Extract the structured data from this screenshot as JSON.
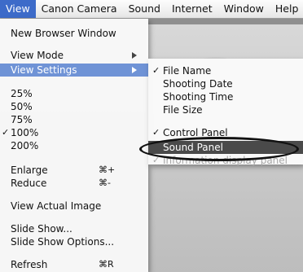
{
  "menubar": {
    "items": [
      "View",
      "Canon Camera",
      "Sound",
      "Internet",
      "Window",
      "Help"
    ],
    "active": "View"
  },
  "view_menu": {
    "new_window": "New Browser Window",
    "view_mode": "View Mode",
    "view_settings": "View Settings",
    "zoom_25": "25%",
    "zoom_50": "50%",
    "zoom_75": "75%",
    "zoom_100": "100%",
    "zoom_200": "200%",
    "enlarge": "Enlarge",
    "enlarge_shortcut": "⌘+",
    "reduce": "Reduce",
    "reduce_shortcut": "⌘-",
    "actual": "View Actual Image",
    "slide_show": "Slide Show...",
    "slide_show_options": "Slide Show Options...",
    "refresh": "Refresh",
    "refresh_shortcut": "⌘R",
    "checked": "100%"
  },
  "view_settings_menu": {
    "file_name": "File Name",
    "shooting_date": "Shooting Date",
    "shooting_time": "Shooting Time",
    "file_size": "File Size",
    "control_panel": "Control Panel",
    "sound_panel": "Sound Panel",
    "information_panel": "Information display panel"
  },
  "checkmark": "✓",
  "colors": {
    "menu_highlight": "#6f93d6",
    "active_title": "#3d6bc9",
    "sound_panel_highlight": "#4a4a4a"
  }
}
